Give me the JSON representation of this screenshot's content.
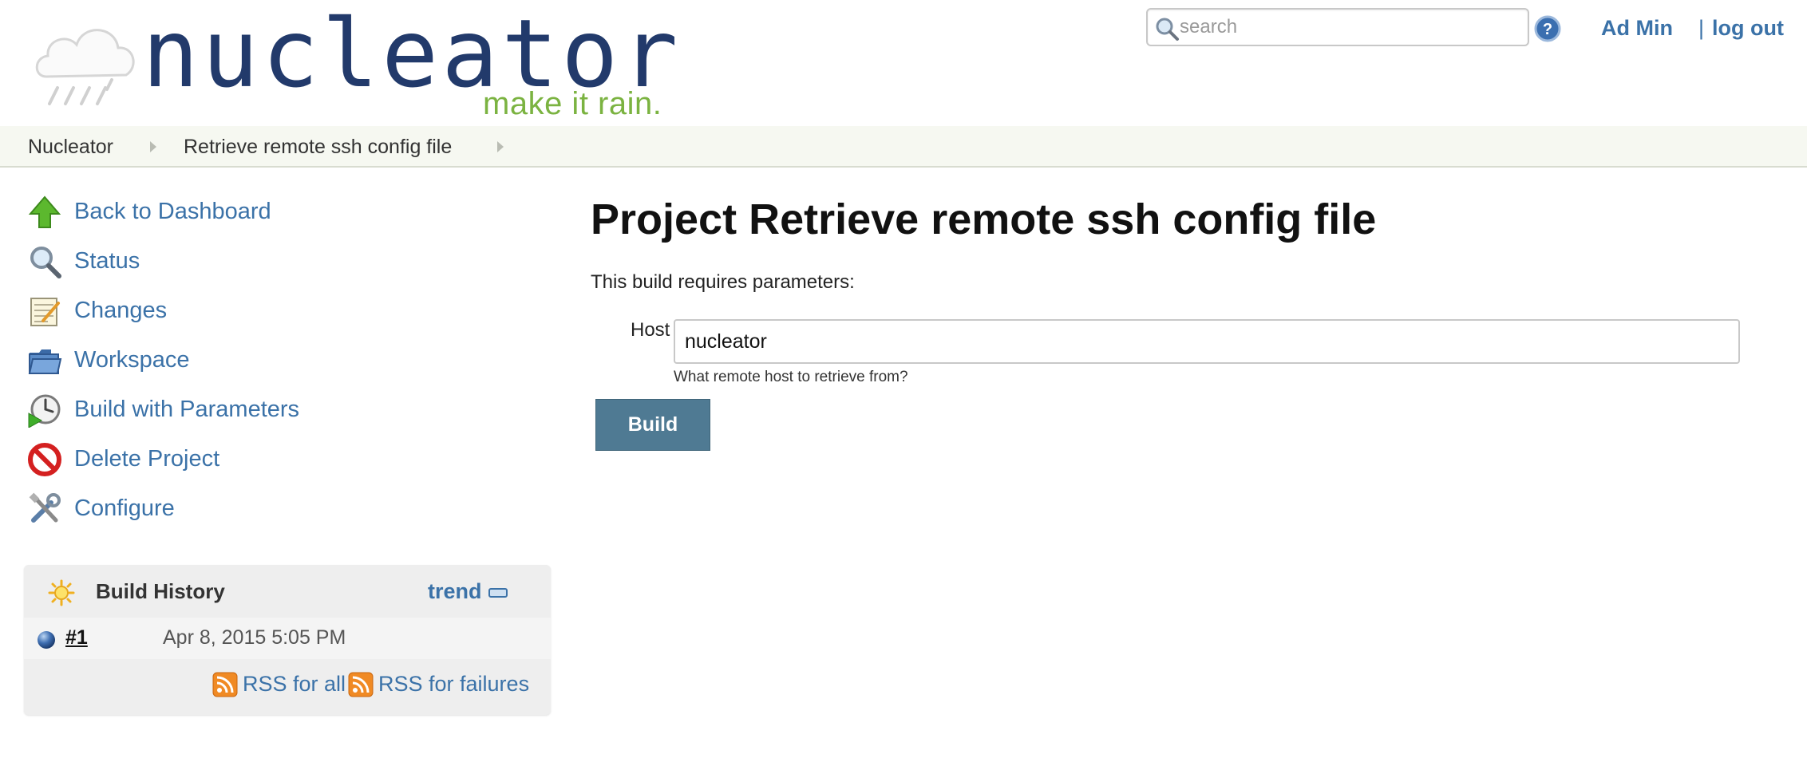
{
  "header": {
    "brand_name": "nucleator",
    "tagline": "make it rain.",
    "search_placeholder": "search",
    "user_name": "Ad Min",
    "logout_separator": "|",
    "logout_label": "log out",
    "icons": {
      "search": "magnifier-icon",
      "help": "question-circle-icon",
      "logo": "rain-cloud-icon"
    }
  },
  "breadcrumb": {
    "items": [
      {
        "label": "Nucleator"
      },
      {
        "label": "Retrieve remote ssh config file"
      }
    ]
  },
  "sidebar": {
    "tasks": [
      {
        "label": "Back to Dashboard",
        "icon": "up-arrow-icon"
      },
      {
        "label": "Status",
        "icon": "magnifier-icon"
      },
      {
        "label": "Changes",
        "icon": "notepad-icon"
      },
      {
        "label": "Workspace",
        "icon": "folder-icon"
      },
      {
        "label": "Build with Parameters",
        "icon": "clock-play-icon"
      },
      {
        "label": "Delete Project",
        "icon": "no-entry-icon"
      },
      {
        "label": "Configure",
        "icon": "tools-icon"
      }
    ]
  },
  "build_history": {
    "title": "Build History",
    "trend_label": "trend",
    "builds": [
      {
        "number": "#1",
        "date": "Apr 8, 2015 5:05 PM",
        "status": "blue-ball"
      }
    ],
    "rss_all_label": "RSS for all",
    "rss_failures_label": "RSS for failures"
  },
  "main": {
    "title": "Project Retrieve remote ssh config file",
    "intro": "This build requires parameters:",
    "parameters": [
      {
        "name": "Host",
        "value": "nucleator",
        "description": "What remote host to retrieve from?"
      }
    ],
    "build_button_label": "Build"
  },
  "colors": {
    "link": "#3b72a8",
    "brand": "#223a6b",
    "tagline": "#7bb341",
    "build_button": "#4f7a93",
    "breadcrumb_bg": "#f6f8f1"
  }
}
